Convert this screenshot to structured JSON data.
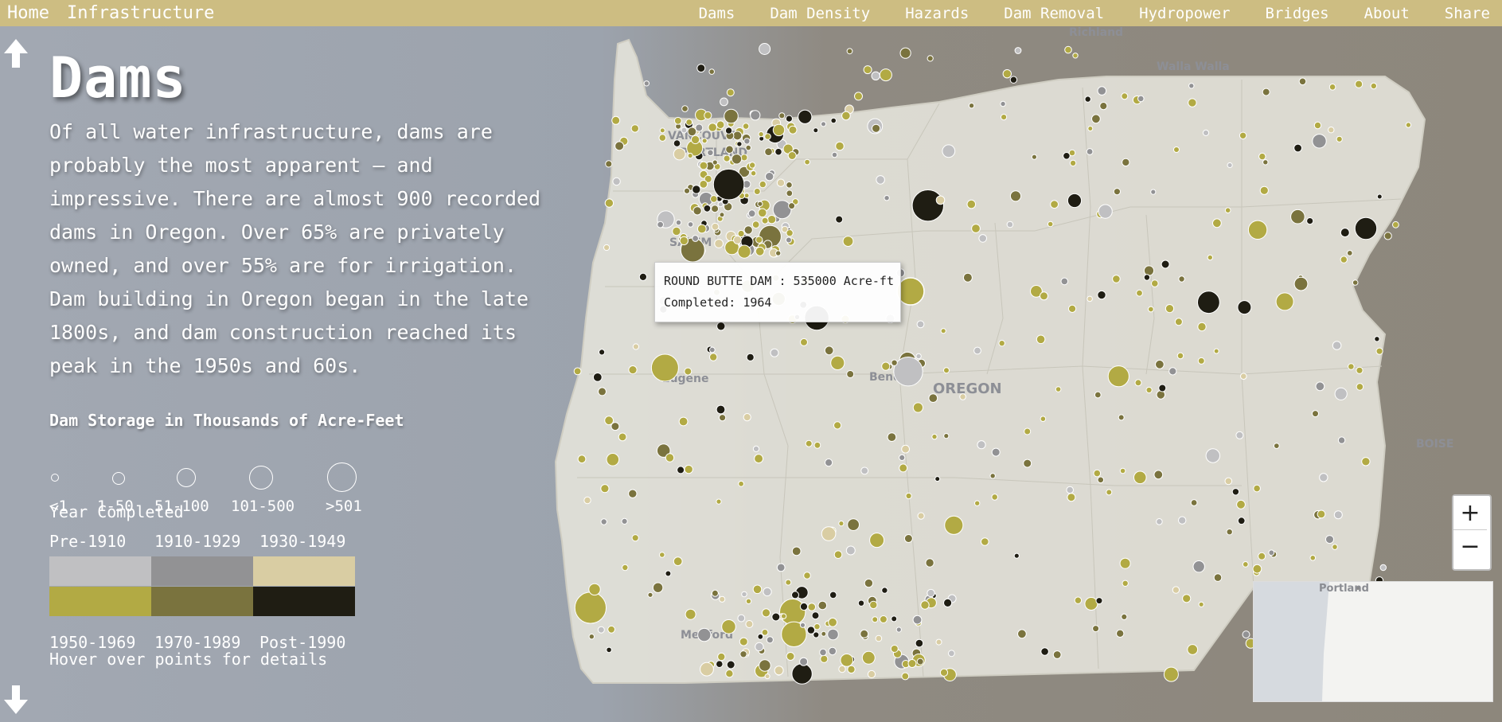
{
  "nav": {
    "home": "Home",
    "section": "Infrastructure",
    "links": [
      "Dams",
      "Dam Density",
      "Hazards",
      "Dam Removal",
      "Hydropower",
      "Bridges",
      "About",
      "Share"
    ]
  },
  "panel": {
    "title": "Dams",
    "intro": "Of all water infrastructure, dams are probably the most apparent – and impressive. There are almost 900 recorded dams in Oregon. Over 65% are privately owned, and over 55% are for irrigation. Dam building in Oregon began in the late 1800s, and dam construction reached its peak in the 1950s and 60s.",
    "storage_legend_title": "Dam Storage in Thousands of Acre-Feet",
    "storage_classes": [
      "<1",
      "1-50",
      "51-100",
      "101-500",
      ">501"
    ],
    "year_legend_title": "Year Completed",
    "year_classes": [
      {
        "label": "Pre-1910",
        "color": "#c0c0c2"
      },
      {
        "label": "1910-1929",
        "color": "#929294"
      },
      {
        "label": "1930-1949",
        "color": "#d9cda3"
      },
      {
        "label": "1950-1969",
        "color": "#b2aa44"
      },
      {
        "label": "1970-1989",
        "color": "#7a733e"
      },
      {
        "label": "Post-1990",
        "color": "#1f1d13"
      }
    ],
    "hover_note": "Hover over points for details"
  },
  "tooltip": {
    "line1": "ROUND BUTTE DAM : 535000 Acre-ft",
    "line2": "Completed: 1964"
  },
  "map_labels": {
    "richland": "Richland",
    "walla_walla": "Walla Walla",
    "vancouver": "VANCOUVER",
    "portland": "PORTLAND",
    "salem": "SALEM",
    "eugene": "Eugene",
    "bend": "Bend",
    "oregon": "OREGON",
    "boise": "BOISE",
    "medford": "Medford",
    "minimap_portland": "Portland"
  },
  "zoom": {
    "in": "+",
    "out": "−"
  },
  "icons": {
    "up": "arrow-up-icon",
    "down": "arrow-down-icon"
  }
}
